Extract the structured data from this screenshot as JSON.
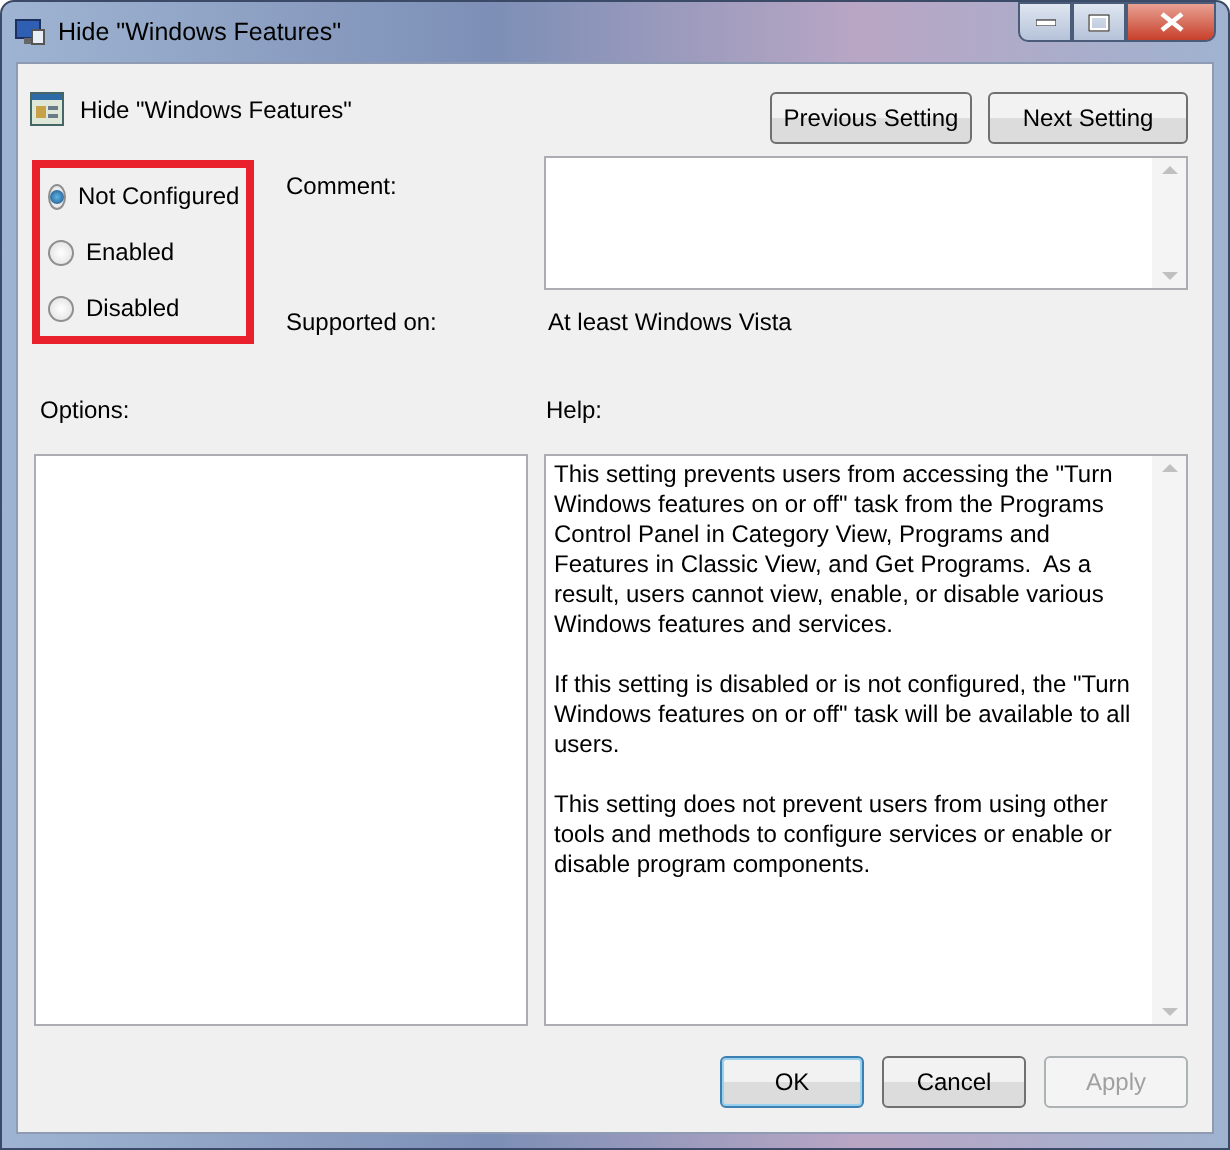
{
  "window": {
    "title": "Hide \"Windows Features\""
  },
  "header": {
    "title": "Hide \"Windows Features\"",
    "buttons": [
      {
        "label": "Previous Setting"
      },
      {
        "label": "Next Setting"
      }
    ]
  },
  "state_options": [
    {
      "label": "Not Configured",
      "selected": true
    },
    {
      "label": "Enabled",
      "selected": false
    },
    {
      "label": "Disabled",
      "selected": false
    }
  ],
  "comment": {
    "label": "Comment:"
  },
  "supported_on": {
    "label": "Supported on:",
    "value": "At least Windows Vista"
  },
  "options": {
    "label": "Options:"
  },
  "help": {
    "label": "Help:",
    "paragraphs": [
      "This setting prevents users from accessing the \"Turn Windows features on or off\" task from the Programs Control Panel in Category View, Programs and Features in Classic View, and Get Programs.  As a result, users cannot view, enable, or disable various Windows features and services.",
      "If this setting is disabled or is not configured, the \"Turn Windows features on or off\" task will be available to all users.",
      "This setting does not prevent users from using other tools and methods to configure services or enable or disable program components."
    ]
  },
  "footer_buttons": [
    {
      "label": "OK",
      "kind": "default",
      "disabled": false
    },
    {
      "label": "Cancel",
      "kind": "normal",
      "disabled": false
    },
    {
      "label": "Apply",
      "kind": "normal",
      "disabled": true
    }
  ]
}
